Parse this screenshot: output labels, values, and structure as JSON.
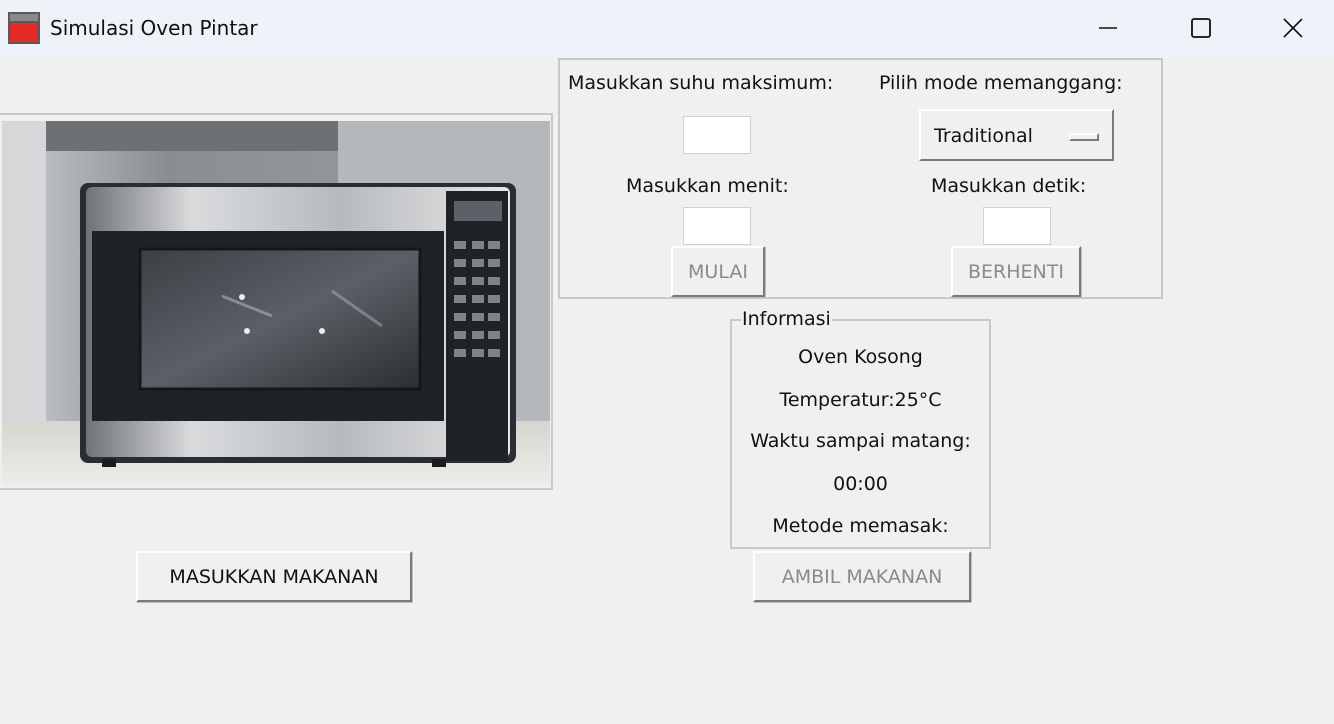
{
  "window": {
    "title": "Simulasi Oven Pintar",
    "minimize_icon": "minimize-icon",
    "maximize_icon": "maximize-icon",
    "close_icon": "close-icon"
  },
  "image": {
    "subject": "oven-photo"
  },
  "controls": {
    "max_temp_label": "Masukkan suhu maksimum:",
    "max_temp_value": "",
    "mode_label": "Pilih mode memanggang:",
    "mode_selected": "Traditional",
    "minutes_label": "Masukkan menit:",
    "minutes_value": "",
    "seconds_label": "Masukkan detik:",
    "seconds_value": "",
    "start_button": "MULAI",
    "stop_button": "BERHENTI"
  },
  "info": {
    "title": "Informasi",
    "status": "Oven Kosong",
    "temperature": "Temperatur:25°C",
    "time_label": "Waktu sampai matang:",
    "time_value": "00:00",
    "method_label": "Metode memasak:"
  },
  "actions": {
    "insert_food": "MASUKKAN MAKANAN",
    "take_food": "AMBIL MAKANAN"
  },
  "colors": {
    "window_bg": "#f0f0f0",
    "titlebar_bg": "#eff3f9",
    "app_icon_red": "#e52b24",
    "disabled_text": "#8a8a8a"
  }
}
